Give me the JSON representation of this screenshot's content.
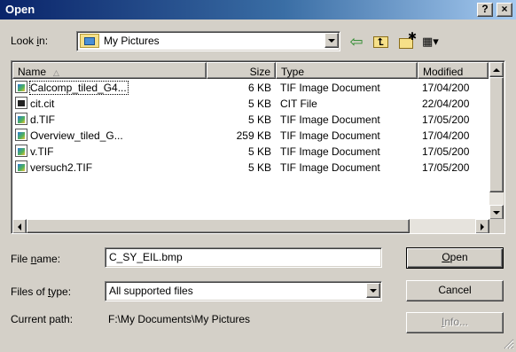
{
  "window": {
    "title": "Open",
    "help_label": "?",
    "close_label": "×"
  },
  "lookin": {
    "label_prefix": "Look ",
    "label_accel": "i",
    "label_suffix": "n:",
    "value": "My Pictures"
  },
  "toolbar": {
    "back_glyph": "⇦",
    "up_glyph": "⮤",
    "new_folder_glyph": "✱",
    "view_glyph": "▦▾"
  },
  "list": {
    "columns": {
      "name": "Name",
      "name_sort_glyph": "△",
      "size": "Size",
      "type": "Type",
      "modified": "Modified"
    },
    "rows": [
      {
        "name": "Calcomp_tiled_G4...",
        "size": "6 KB",
        "type": "TIF Image Document",
        "modified": "17/04/200",
        "icon": "tif-file-icon"
      },
      {
        "name": "cit.cit",
        "size": "5 KB",
        "type": "CIT File",
        "modified": "22/04/200",
        "icon": "cit-file-icon"
      },
      {
        "name": "d.TIF",
        "size": "5 KB",
        "type": "TIF Image Document",
        "modified": "17/05/200",
        "icon": "tif-file-icon"
      },
      {
        "name": "Overview_tiled_G...",
        "size": "259 KB",
        "type": "TIF Image Document",
        "modified": "17/04/200",
        "icon": "tif-file-icon"
      },
      {
        "name": "v.TIF",
        "size": "5 KB",
        "type": "TIF Image Document",
        "modified": "17/05/200",
        "icon": "tif-file-icon"
      },
      {
        "name": "versuch2.TIF",
        "size": "5 KB",
        "type": "TIF Image Document",
        "modified": "17/05/200",
        "icon": "tif-file-icon"
      }
    ]
  },
  "filename": {
    "label_prefix": "File ",
    "label_accel": "n",
    "label_suffix": "ame:",
    "value": "C_SY_EIL.bmp"
  },
  "filetype": {
    "label_prefix": "Files of ",
    "label_accel": "t",
    "label_suffix": "ype:",
    "value": "All supported files"
  },
  "current_path": {
    "label": "Current path:",
    "value": "F:\\My Documents\\My Pictures"
  },
  "buttons": {
    "open_accel": "O",
    "open_rest": "pen",
    "cancel": "Cancel",
    "info_accel": "I",
    "info_rest": "nfo..."
  },
  "colors": {
    "title_start": "#0a246a",
    "title_end": "#a6caf0",
    "face": "#d4d0c8"
  }
}
